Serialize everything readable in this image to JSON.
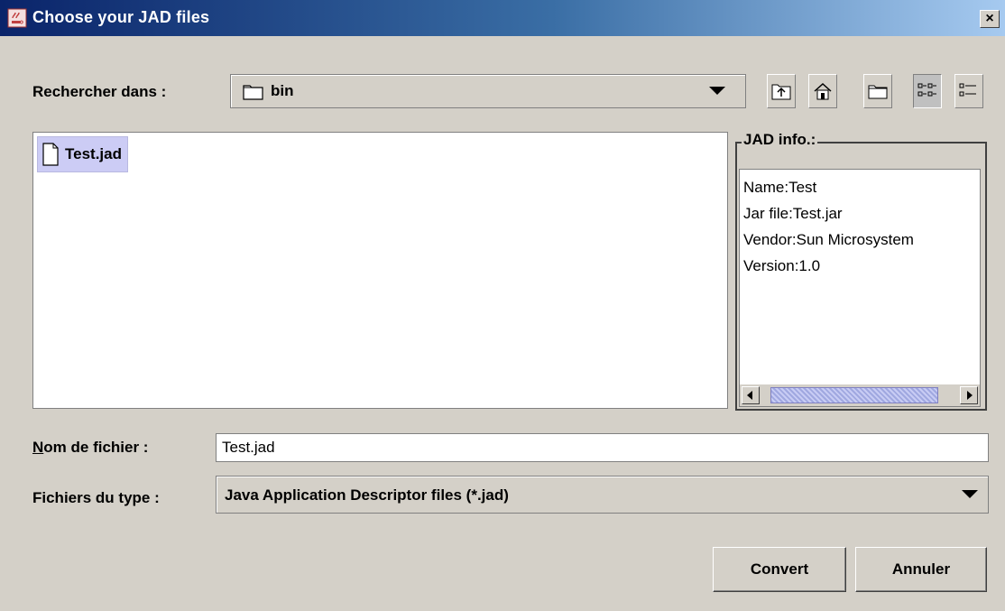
{
  "window": {
    "title": "Choose your JAD files",
    "close_symbol": "×",
    "icon": "java-coffee-icon"
  },
  "look_in": {
    "label": "Rechercher dans :",
    "value": "bin",
    "icon": "folder-icon"
  },
  "toolbar": {
    "buttons": [
      {
        "name": "up-one-level-icon"
      },
      {
        "name": "home-icon"
      },
      {
        "name": "new-folder-icon"
      },
      {
        "name": "list-view-icon",
        "pressed": true
      },
      {
        "name": "details-view-icon"
      }
    ]
  },
  "file_list": {
    "items": [
      {
        "name": "Test.jad",
        "icon": "file-icon",
        "selected": true
      }
    ]
  },
  "jad_info": {
    "title": "JAD info.:",
    "lines": [
      "Name:Test",
      "Jar file:Test.jar",
      "Vendor:Sun Microsystem",
      "Version:1.0"
    ]
  },
  "file_name": {
    "label_first": "N",
    "label_rest": "om de fichier :",
    "value": "Test.jad"
  },
  "file_type": {
    "label": "Fichiers du type :",
    "value": "Java Application Descriptor files (*.jad)"
  },
  "buttons": {
    "convert": "Convert",
    "cancel": "Annuler"
  },
  "colors": {
    "title_gradient_start": "#0a246a",
    "title_gradient_end": "#a6caf0",
    "panel": "#d4d0c8",
    "selection": "#ccccf5"
  }
}
